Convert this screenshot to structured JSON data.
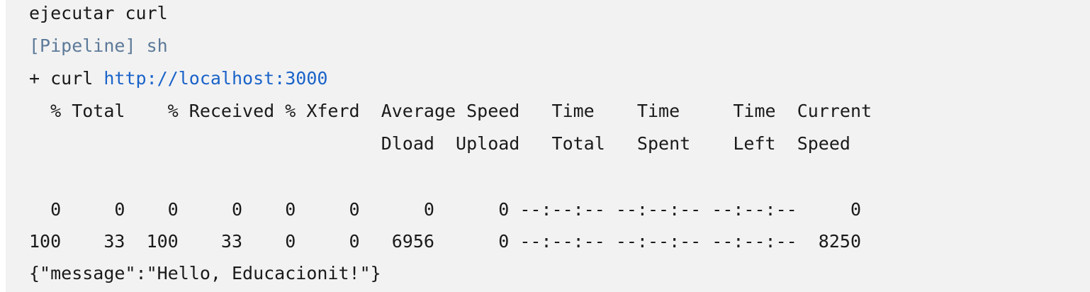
{
  "console": {
    "lines": {
      "command_label": "ejecutar curl",
      "pipeline_tag": "[Pipeline] sh",
      "curl_prefix": "+ curl ",
      "curl_url": "http://localhost:3000",
      "header_row_1": "  % Total    % Received % Xferd  Average Speed   Time    Time     Time  Current",
      "header_row_2": "                                 Dload  Upload   Total   Spent    Left  Speed",
      "progress_row_1": "  0     0    0     0    0     0      0      0 --:--:-- --:--:-- --:--:--     0",
      "progress_row_2": "100    33  100    33    0     0   6956      0 --:--:-- --:--:-- --:--:--  8250",
      "response_body": "{\"message\":\"Hello, Educacionit!\"}"
    }
  }
}
